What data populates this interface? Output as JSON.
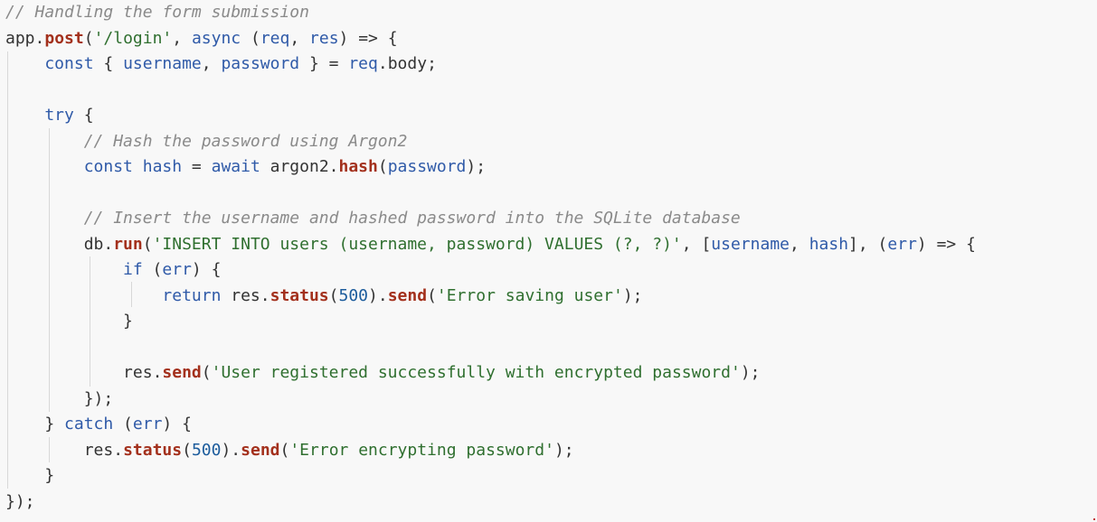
{
  "editor": {
    "lines": [
      [
        {
          "t": "// Handling the form submission",
          "c": "comment"
        }
      ],
      [
        {
          "t": "app",
          "c": "plain"
        },
        {
          "t": ".",
          "c": "punct"
        },
        {
          "t": "post",
          "c": "fn"
        },
        {
          "t": "(",
          "c": "punct"
        },
        {
          "t": "'/login'",
          "c": "string"
        },
        {
          "t": ", ",
          "c": "punct"
        },
        {
          "t": "async",
          "c": "keyword"
        },
        {
          "t": " (",
          "c": "punct"
        },
        {
          "t": "req",
          "c": "param"
        },
        {
          "t": ", ",
          "c": "punct"
        },
        {
          "t": "res",
          "c": "param"
        },
        {
          "t": ") => {",
          "c": "punct"
        }
      ],
      [
        {
          "t": "    const",
          "c": "keyword"
        },
        {
          "t": " { ",
          "c": "punct"
        },
        {
          "t": "username",
          "c": "var"
        },
        {
          "t": ", ",
          "c": "punct"
        },
        {
          "t": "password",
          "c": "var"
        },
        {
          "t": " } = ",
          "c": "punct"
        },
        {
          "t": "req",
          "c": "param"
        },
        {
          "t": ".",
          "c": "punct"
        },
        {
          "t": "body",
          "c": "prop"
        },
        {
          "t": ";",
          "c": "punct"
        }
      ],
      [
        {
          "t": "",
          "c": "plain"
        }
      ],
      [
        {
          "t": "    try",
          "c": "keyword"
        },
        {
          "t": " {",
          "c": "punct"
        }
      ],
      [
        {
          "t": "        // Hash the password using Argon2",
          "c": "comment"
        }
      ],
      [
        {
          "t": "        const",
          "c": "keyword"
        },
        {
          "t": " ",
          "c": "plain"
        },
        {
          "t": "hash",
          "c": "var"
        },
        {
          "t": " = ",
          "c": "punct"
        },
        {
          "t": "await",
          "c": "keyword"
        },
        {
          "t": " argon2",
          "c": "plain"
        },
        {
          "t": ".",
          "c": "punct"
        },
        {
          "t": "hash",
          "c": "fn"
        },
        {
          "t": "(",
          "c": "punct"
        },
        {
          "t": "password",
          "c": "var"
        },
        {
          "t": ");",
          "c": "punct"
        }
      ],
      [
        {
          "t": "",
          "c": "plain"
        }
      ],
      [
        {
          "t": "        // Insert the username and hashed password into the SQLite database",
          "c": "comment"
        }
      ],
      [
        {
          "t": "        db",
          "c": "plain"
        },
        {
          "t": ".",
          "c": "punct"
        },
        {
          "t": "run",
          "c": "fn"
        },
        {
          "t": "(",
          "c": "punct"
        },
        {
          "t": "'INSERT INTO users (username, password) VALUES (?, ?)'",
          "c": "string"
        },
        {
          "t": ", [",
          "c": "punct"
        },
        {
          "t": "username",
          "c": "var"
        },
        {
          "t": ", ",
          "c": "punct"
        },
        {
          "t": "hash",
          "c": "var"
        },
        {
          "t": "], (",
          "c": "punct"
        },
        {
          "t": "err",
          "c": "param"
        },
        {
          "t": ") => {",
          "c": "punct"
        }
      ],
      [
        {
          "t": "            if",
          "c": "keyword"
        },
        {
          "t": " (",
          "c": "punct"
        },
        {
          "t": "err",
          "c": "param"
        },
        {
          "t": ") {",
          "c": "punct"
        }
      ],
      [
        {
          "t": "                return",
          "c": "keyword"
        },
        {
          "t": " res",
          "c": "plain"
        },
        {
          "t": ".",
          "c": "punct"
        },
        {
          "t": "status",
          "c": "fn"
        },
        {
          "t": "(",
          "c": "punct"
        },
        {
          "t": "500",
          "c": "num"
        },
        {
          "t": ").",
          "c": "punct"
        },
        {
          "t": "send",
          "c": "fn"
        },
        {
          "t": "(",
          "c": "punct"
        },
        {
          "t": "'Error saving user'",
          "c": "string"
        },
        {
          "t": ");",
          "c": "punct"
        }
      ],
      [
        {
          "t": "            }",
          "c": "punct"
        }
      ],
      [
        {
          "t": "",
          "c": "plain"
        }
      ],
      [
        {
          "t": "            res",
          "c": "plain"
        },
        {
          "t": ".",
          "c": "punct"
        },
        {
          "t": "send",
          "c": "fn"
        },
        {
          "t": "(",
          "c": "punct"
        },
        {
          "t": "'User registered successfully with encrypted password'",
          "c": "string"
        },
        {
          "t": ");",
          "c": "punct"
        }
      ],
      [
        {
          "t": "        });",
          "c": "punct"
        }
      ],
      [
        {
          "t": "    } ",
          "c": "punct"
        },
        {
          "t": "catch",
          "c": "keyword"
        },
        {
          "t": " (",
          "c": "punct"
        },
        {
          "t": "err",
          "c": "param"
        },
        {
          "t": ") {",
          "c": "punct"
        }
      ],
      [
        {
          "t": "        res",
          "c": "plain"
        },
        {
          "t": ".",
          "c": "punct"
        },
        {
          "t": "status",
          "c": "fn"
        },
        {
          "t": "(",
          "c": "punct"
        },
        {
          "t": "500",
          "c": "num"
        },
        {
          "t": ").",
          "c": "punct"
        },
        {
          "t": "send",
          "c": "fn"
        },
        {
          "t": "(",
          "c": "punct"
        },
        {
          "t": "'Error encrypting password'",
          "c": "string"
        },
        {
          "t": ");",
          "c": "punct"
        }
      ],
      [
        {
          "t": "    }",
          "c": "punct"
        }
      ],
      [
        {
          "t": "});",
          "c": "punct"
        }
      ]
    ]
  }
}
